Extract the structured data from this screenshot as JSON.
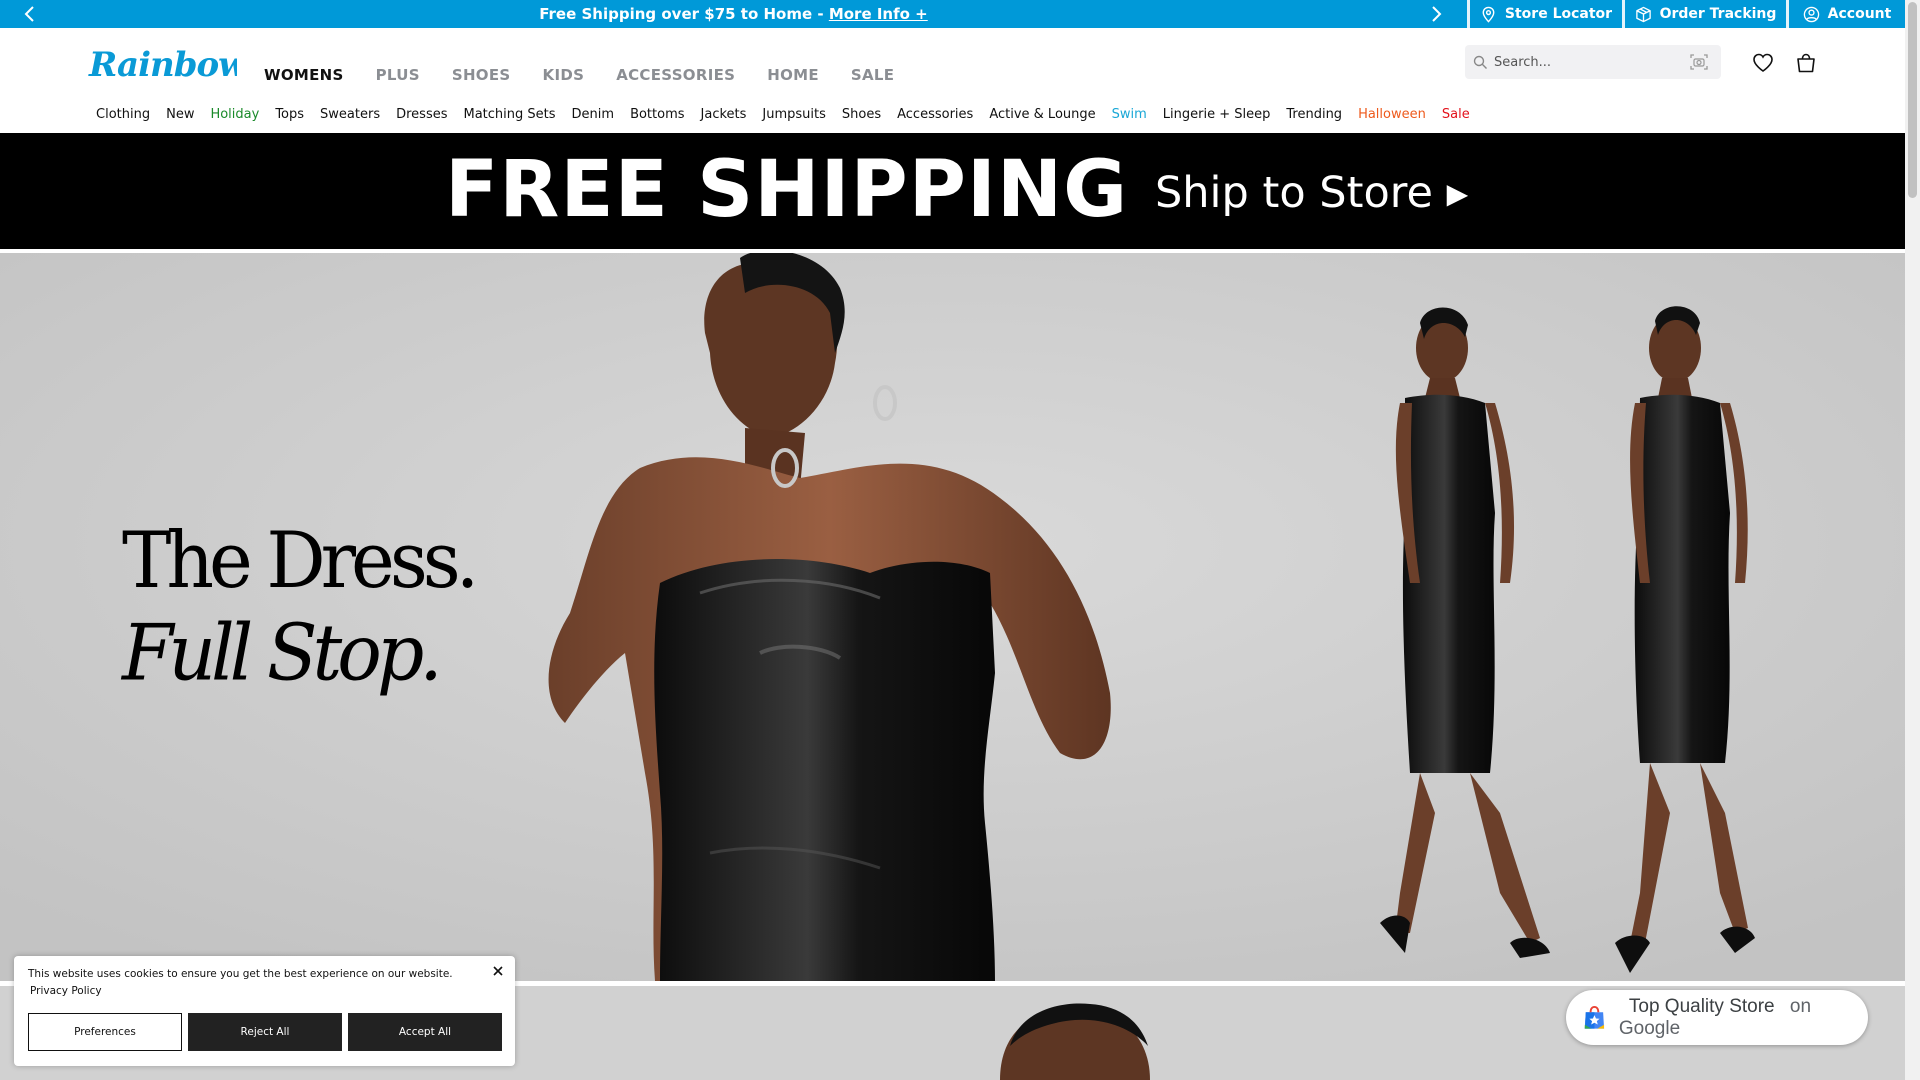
{
  "promo": {
    "message": "Free Shipping over $75 to Home - ",
    "link_label": "More Info +",
    "store_locator": "Store Locator",
    "order_tracking": "Order Tracking",
    "account": "Account"
  },
  "header": {
    "logo_text": "Rainbow",
    "departments": [
      "WOMENS",
      "PLUS",
      "SHOES",
      "KIDS",
      "ACCESSORIES",
      "HOME",
      "SALE"
    ],
    "active_department": "WOMENS",
    "search_placeholder": "Search..."
  },
  "categories": [
    {
      "label": "Clothing",
      "color": "#111111"
    },
    {
      "label": "New",
      "color": "#111111"
    },
    {
      "label": "Holiday",
      "color": "#1a8a2a"
    },
    {
      "label": "Tops",
      "color": "#111111"
    },
    {
      "label": "Sweaters",
      "color": "#111111"
    },
    {
      "label": "Dresses",
      "color": "#111111"
    },
    {
      "label": "Matching Sets",
      "color": "#111111"
    },
    {
      "label": "Denim",
      "color": "#111111"
    },
    {
      "label": "Bottoms",
      "color": "#111111"
    },
    {
      "label": "Jackets",
      "color": "#111111"
    },
    {
      "label": "Jumpsuits",
      "color": "#111111"
    },
    {
      "label": "Shoes",
      "color": "#111111"
    },
    {
      "label": "Accessories",
      "color": "#111111"
    },
    {
      "label": "Active & Lounge",
      "color": "#111111"
    },
    {
      "label": "Swim",
      "color": "#19a7d6"
    },
    {
      "label": "Lingerie + Sleep",
      "color": "#111111"
    },
    {
      "label": "Trending",
      "color": "#111111"
    },
    {
      "label": "Halloween",
      "color": "#ee5a1c"
    },
    {
      "label": "Sale",
      "color": "#e3121b"
    }
  ],
  "ship_banner": {
    "main": "FREE SHIPPING",
    "sub": "Ship to Store ▸"
  },
  "hero": {
    "headline_line1": "The Dress.",
    "headline_line2": "Full Stop."
  },
  "cookie": {
    "message": "This website uses cookies to ensure you get the best experience on our website.",
    "policy_link": "Privacy Policy",
    "preferences": "Preferences",
    "reject": "Reject All",
    "accept": "Accept All"
  },
  "google_badge": {
    "text": "Top Quality Store",
    "suffix": " on Google"
  },
  "colors": {
    "brand_blue": "#0099d8",
    "banner_black": "#000000"
  },
  "icons": [
    "chevron-left-icon",
    "chevron-right-icon",
    "map-pin-icon",
    "box-icon",
    "user-icon",
    "search-icon",
    "camera-icon",
    "heart-icon",
    "bag-icon",
    "close-icon",
    "google-shopping-icon"
  ]
}
